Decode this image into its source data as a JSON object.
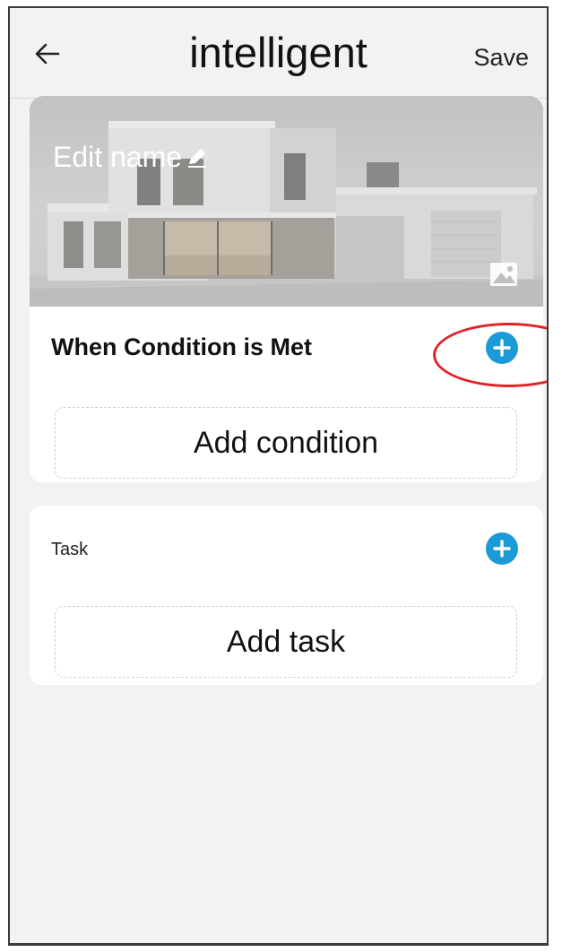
{
  "header": {
    "title": "intelligent",
    "save_label": "Save",
    "back_icon": "arrow-left-icon"
  },
  "hero": {
    "edit_name_label": "Edit name",
    "edit_icon": "pencil-icon",
    "change_image_icon": "image-icon"
  },
  "condition_section": {
    "title": "When Condition is Met",
    "add_icon": "plus-circle-icon",
    "placeholder_label": "Add condition",
    "highlight_color": "#e0232a"
  },
  "task_section": {
    "title": "Task",
    "add_icon": "plus-circle-icon",
    "placeholder_label": "Add task"
  },
  "colors": {
    "accent": "#1a9bd7",
    "background": "#f2f2f2",
    "card": "#ffffff"
  }
}
